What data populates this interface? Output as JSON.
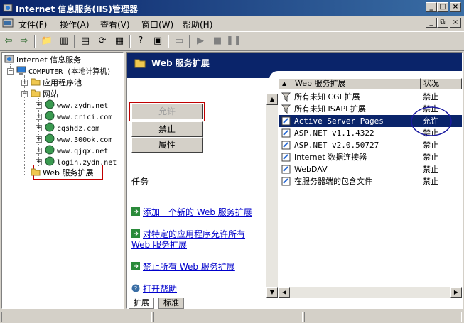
{
  "window": {
    "title": "Internet 信息服务(IIS)管理器",
    "controls": [
      "minimize",
      "maximize",
      "close"
    ]
  },
  "menubar": {
    "items": [
      "文件(F)",
      "操作(A)",
      "查看(V)",
      "窗口(W)",
      "帮助(H)"
    ]
  },
  "toolbar": {
    "icons": [
      "back-icon",
      "forward-icon",
      "up-icon",
      "show-tree-icon",
      "properties-icon",
      "refresh-icon",
      "export-icon",
      "help-icon",
      "console-icon",
      "computer-icon",
      "play-icon",
      "stop-icon",
      "pause-icon"
    ]
  },
  "tree": {
    "root": "Internet 信息服务",
    "computer": "COMPUTER (本地计算机)",
    "app_pools": "应用程序池",
    "websites": "网站",
    "sites": [
      "www.zydn.net",
      "www.crici.com",
      "cqshdz.com",
      "www.300ok.com",
      "www.qjqx.net",
      "login.zydn.net"
    ],
    "web_ext": "Web 服务扩展"
  },
  "rightpane": {
    "banner_title": "Web 服务扩展",
    "buttons": {
      "allow": "允许",
      "prohibit": "禁止",
      "properties": "属性"
    },
    "tasks_label": "任务",
    "tasks": [
      "添加一个新的 Web 服务扩展",
      "对特定的应用程序允许所有",
      "Web 服务扩展",
      "禁止所有 Web 服务扩展",
      "打开帮助"
    ]
  },
  "listview": {
    "headers": [
      "Web 服务扩展",
      "状况"
    ],
    "rows": [
      {
        "name": "所有未知 CGI 扩展",
        "status": "禁止",
        "icon": "filter-icon"
      },
      {
        "name": "所有未知 ISAPI 扩展",
        "status": "禁止",
        "icon": "filter-icon"
      },
      {
        "name": "Active Server Pages",
        "status": "允许",
        "icon": "extension-icon",
        "selected": true
      },
      {
        "name": "ASP.NET v1.1.4322",
        "status": "禁止",
        "icon": "extension-icon"
      },
      {
        "name": "ASP.NET v2.0.50727",
        "status": "禁止",
        "icon": "extension-icon"
      },
      {
        "name": "Internet 数据连接器",
        "status": "禁止",
        "icon": "extension-icon"
      },
      {
        "name": "WebDAV",
        "status": "禁止",
        "icon": "extension-icon"
      },
      {
        "name": "在服务器端的包含文件",
        "status": "禁止",
        "icon": "extension-icon"
      }
    ]
  },
  "tabs": [
    "扩展",
    "标准"
  ]
}
